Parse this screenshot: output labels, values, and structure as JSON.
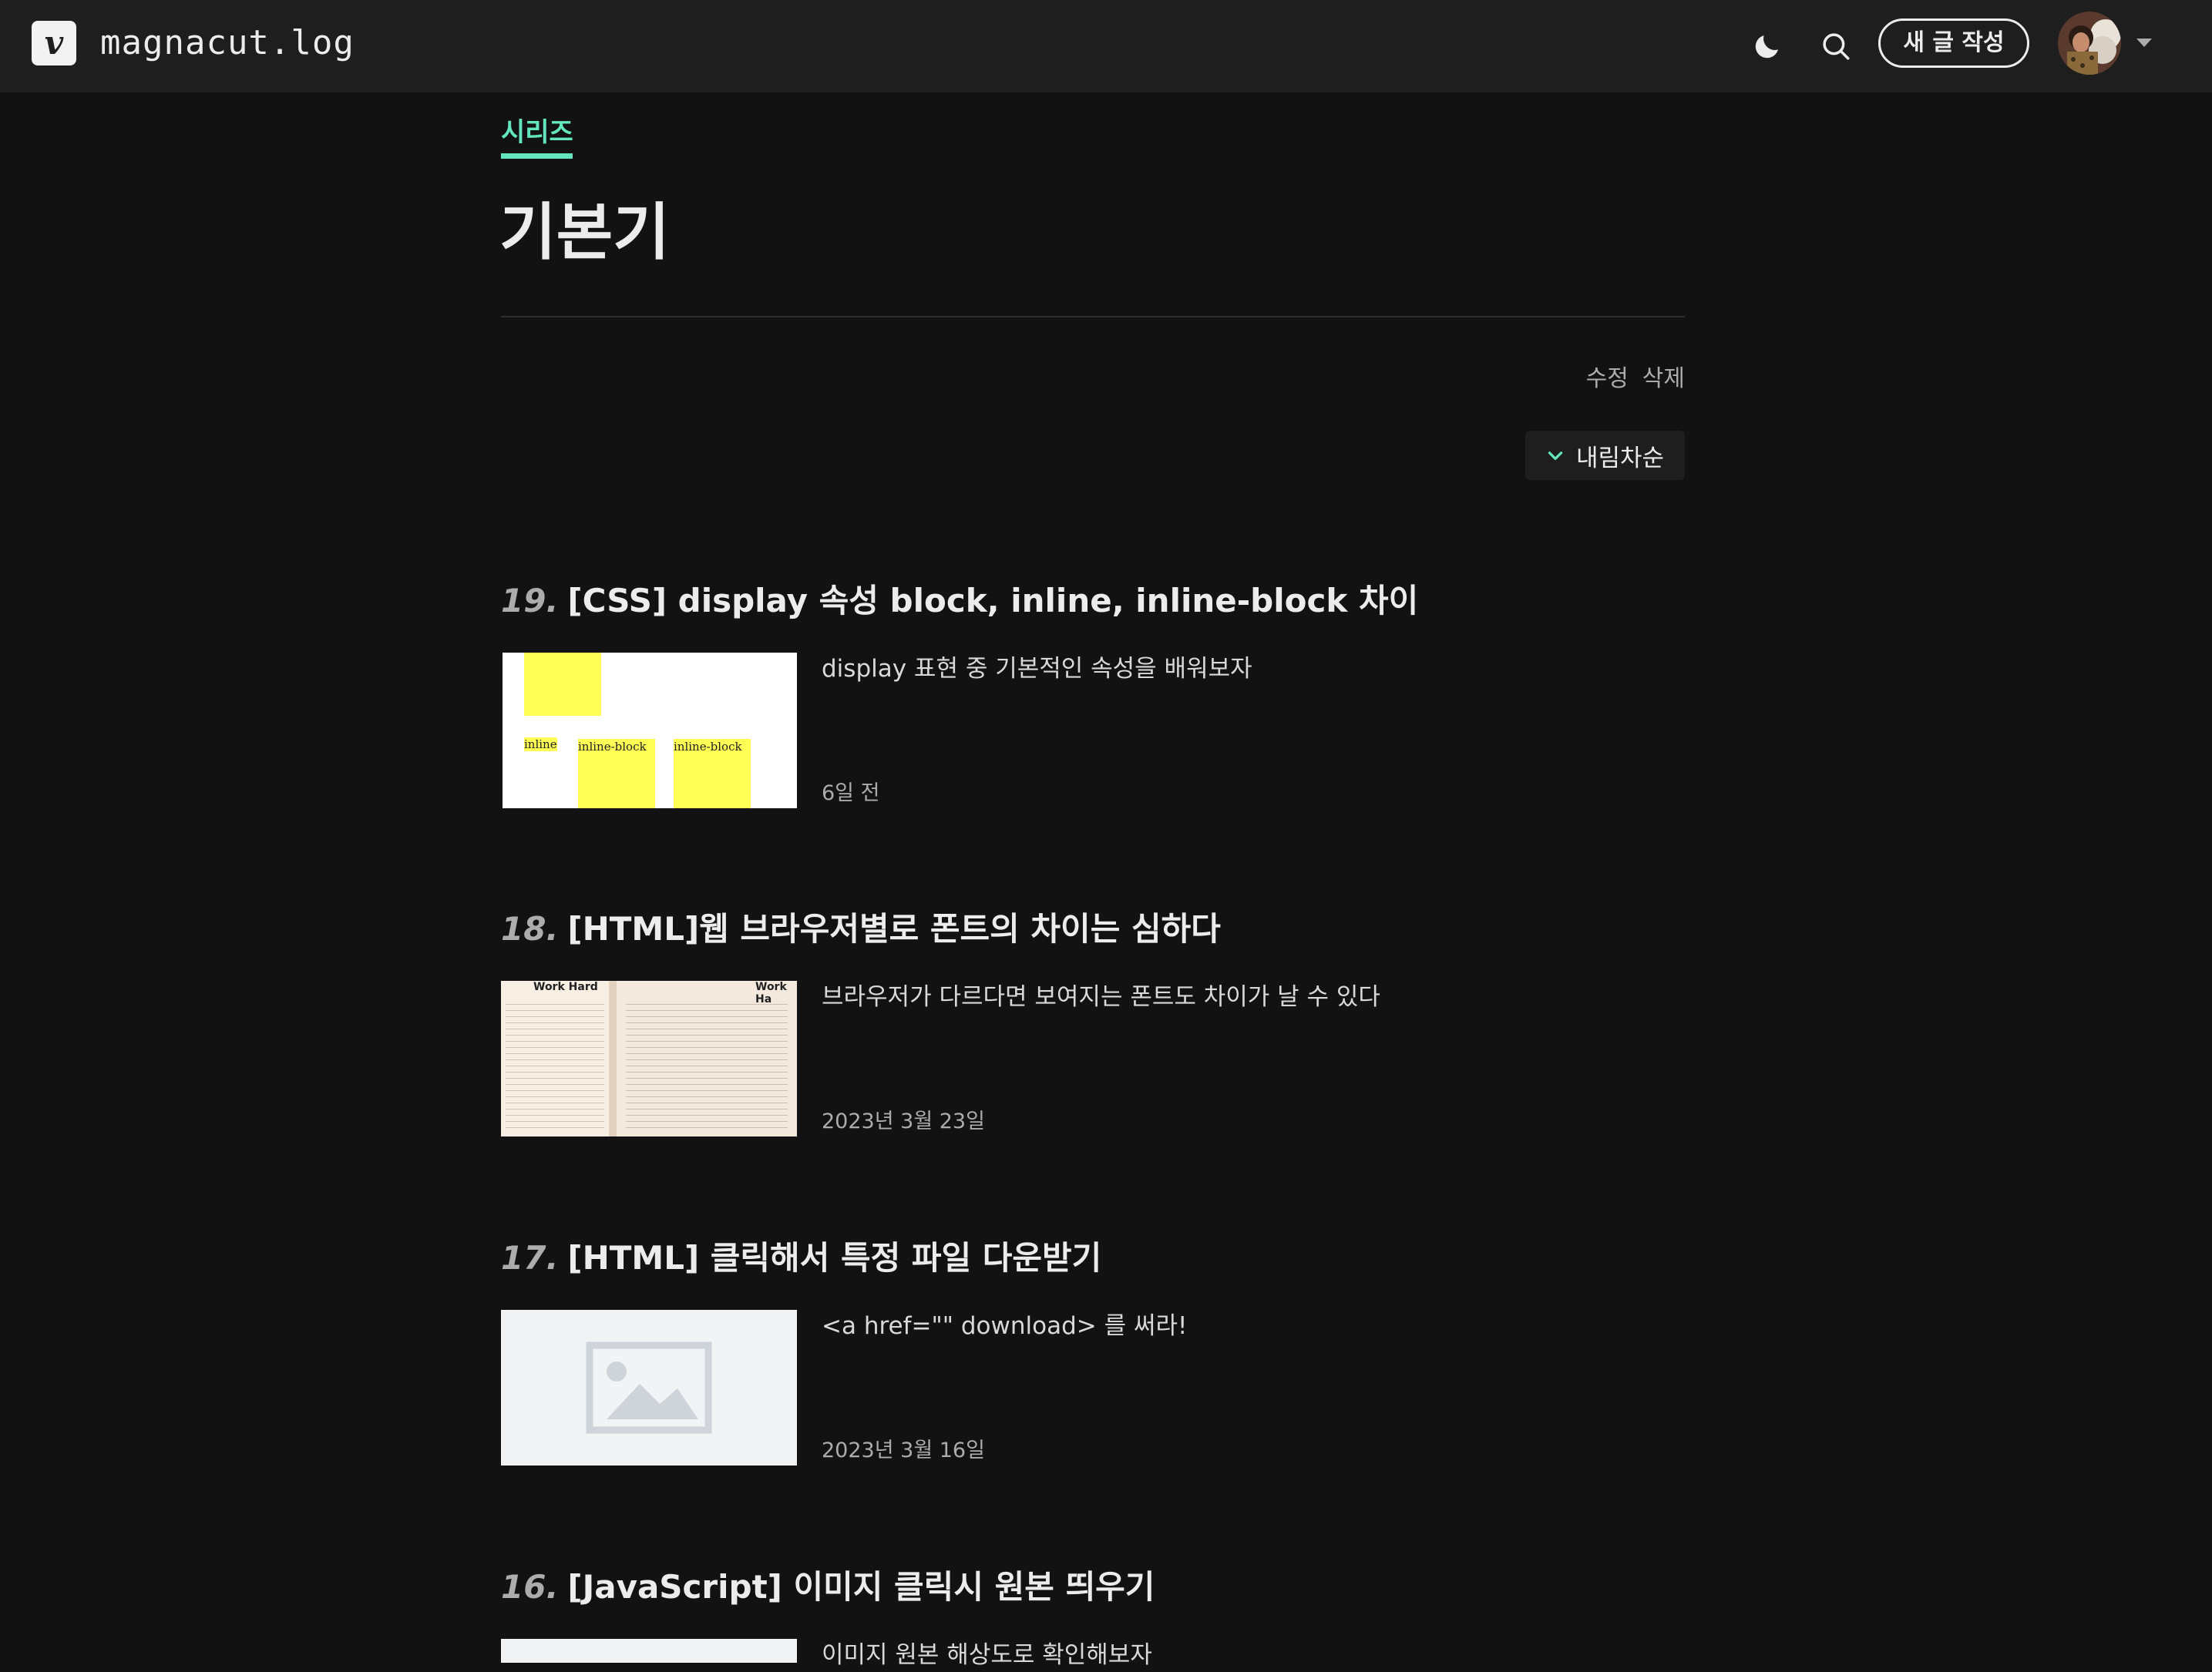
{
  "header": {
    "logo_letter": "v",
    "blog_title": "magnacut.log",
    "new_post_label": "새 글 작성"
  },
  "series": {
    "tab_label": "시리즈",
    "title": "기본기",
    "edit_label": "수정",
    "delete_label": "삭제",
    "sort_label": "내림차순"
  },
  "posts": [
    {
      "number": "19.",
      "title": "[CSS] display 속성 block, inline, inline-block 차이",
      "description": "display 표현 중 기본적인 속성을 배워보자",
      "date": "6일 전",
      "thumbnail": {
        "label_inline": "inline",
        "label_inline_block_1": "inline-block",
        "label_inline_block_2": "inline-block"
      }
    },
    {
      "number": "18.",
      "title": "[HTML]웹 브라우저별로 폰트의 차이는 심하다",
      "description": "브라우저가 다르다면 보여지는 폰트도 차이가 날 수 있다",
      "date": "2023년 3월 23일",
      "thumbnail": {
        "heading_left": "Work Hard",
        "heading_right": "Work Ha"
      }
    },
    {
      "number": "17.",
      "title": "[HTML] 클릭해서 특정 파일 다운받기",
      "description": "<a href=\"\" download> 를 써라!",
      "date": "2023년 3월 16일"
    },
    {
      "number": "16.",
      "title": "[JavaScript] 이미지 클릭시 원본 띄우기",
      "description": "이미지 원본 해상도로 확인해보자"
    }
  ],
  "colors": {
    "accent": "#63e6be",
    "background": "#121212",
    "header_background": "#1e1e1e",
    "thumbnail_yellow": "#ffff55"
  },
  "icons": {
    "theme": "moon-icon",
    "search": "search-icon",
    "sort": "chevron-down-icon",
    "placeholder": "image-placeholder-icon"
  }
}
